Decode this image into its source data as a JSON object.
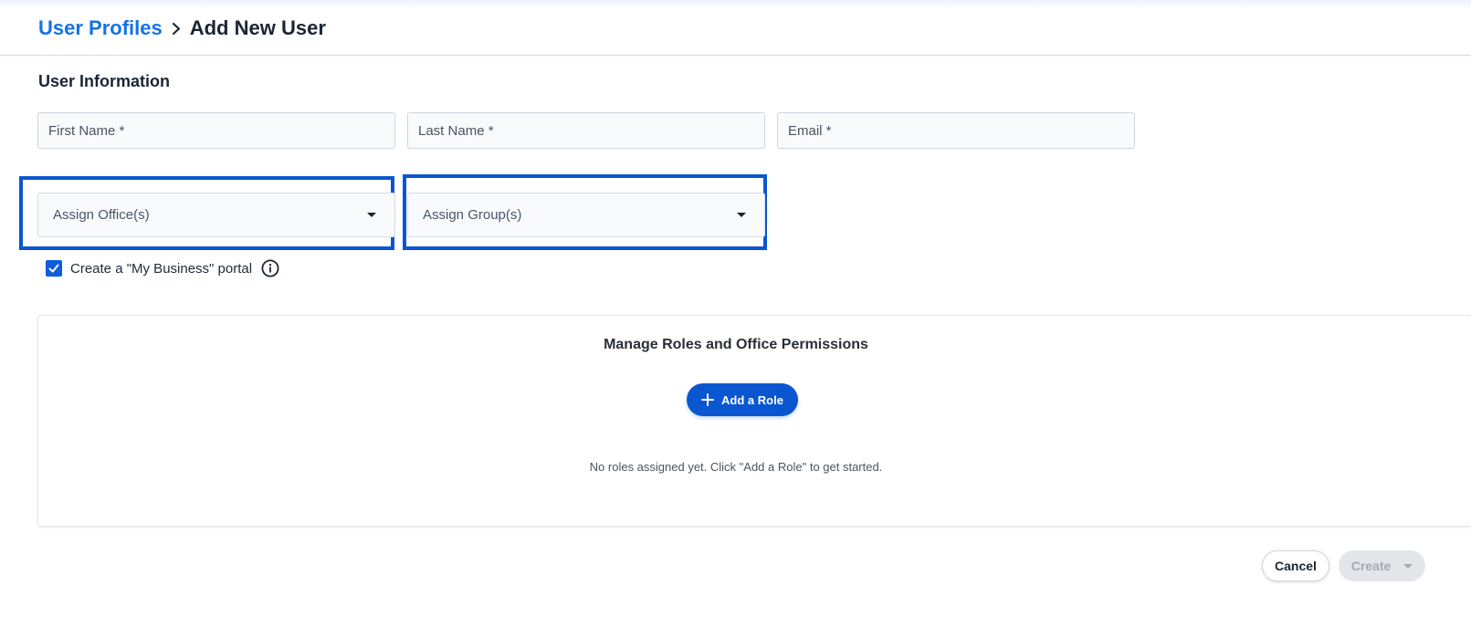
{
  "breadcrumb": {
    "parent": "User Profiles",
    "current": "Add New User"
  },
  "user_info": {
    "section_title": "User Information",
    "first_name": {
      "placeholder": "First Name *",
      "value": ""
    },
    "last_name": {
      "placeholder": "Last Name *",
      "value": ""
    },
    "email": {
      "placeholder": "Email *",
      "value": ""
    },
    "assign_offices": {
      "label": "Assign Office(s)"
    },
    "assign_groups": {
      "label": "Assign Group(s)"
    },
    "portal_checkbox": {
      "label": "Create a \"My Business\" portal",
      "checked": true
    }
  },
  "roles": {
    "title": "Manage Roles and Office Permissions",
    "add_role_label": "Add a Role",
    "empty_message": "No roles assigned yet. Click \"Add a Role\" to get started."
  },
  "actions": {
    "cancel_label": "Cancel",
    "create_label": "Create",
    "create_disabled": true
  },
  "colors": {
    "link": "#1473e6",
    "primary": "#0a56d0",
    "highlight": "#0a56d0",
    "disabled_bg": "#e3e5e8",
    "disabled_text": "#a5abb3"
  },
  "icons": {
    "breadcrumb_separator": "chevron-right-icon",
    "dropdown": "caret-down-icon",
    "checkbox": "check-icon",
    "info": "info-icon",
    "add_role": "plus-icon"
  }
}
